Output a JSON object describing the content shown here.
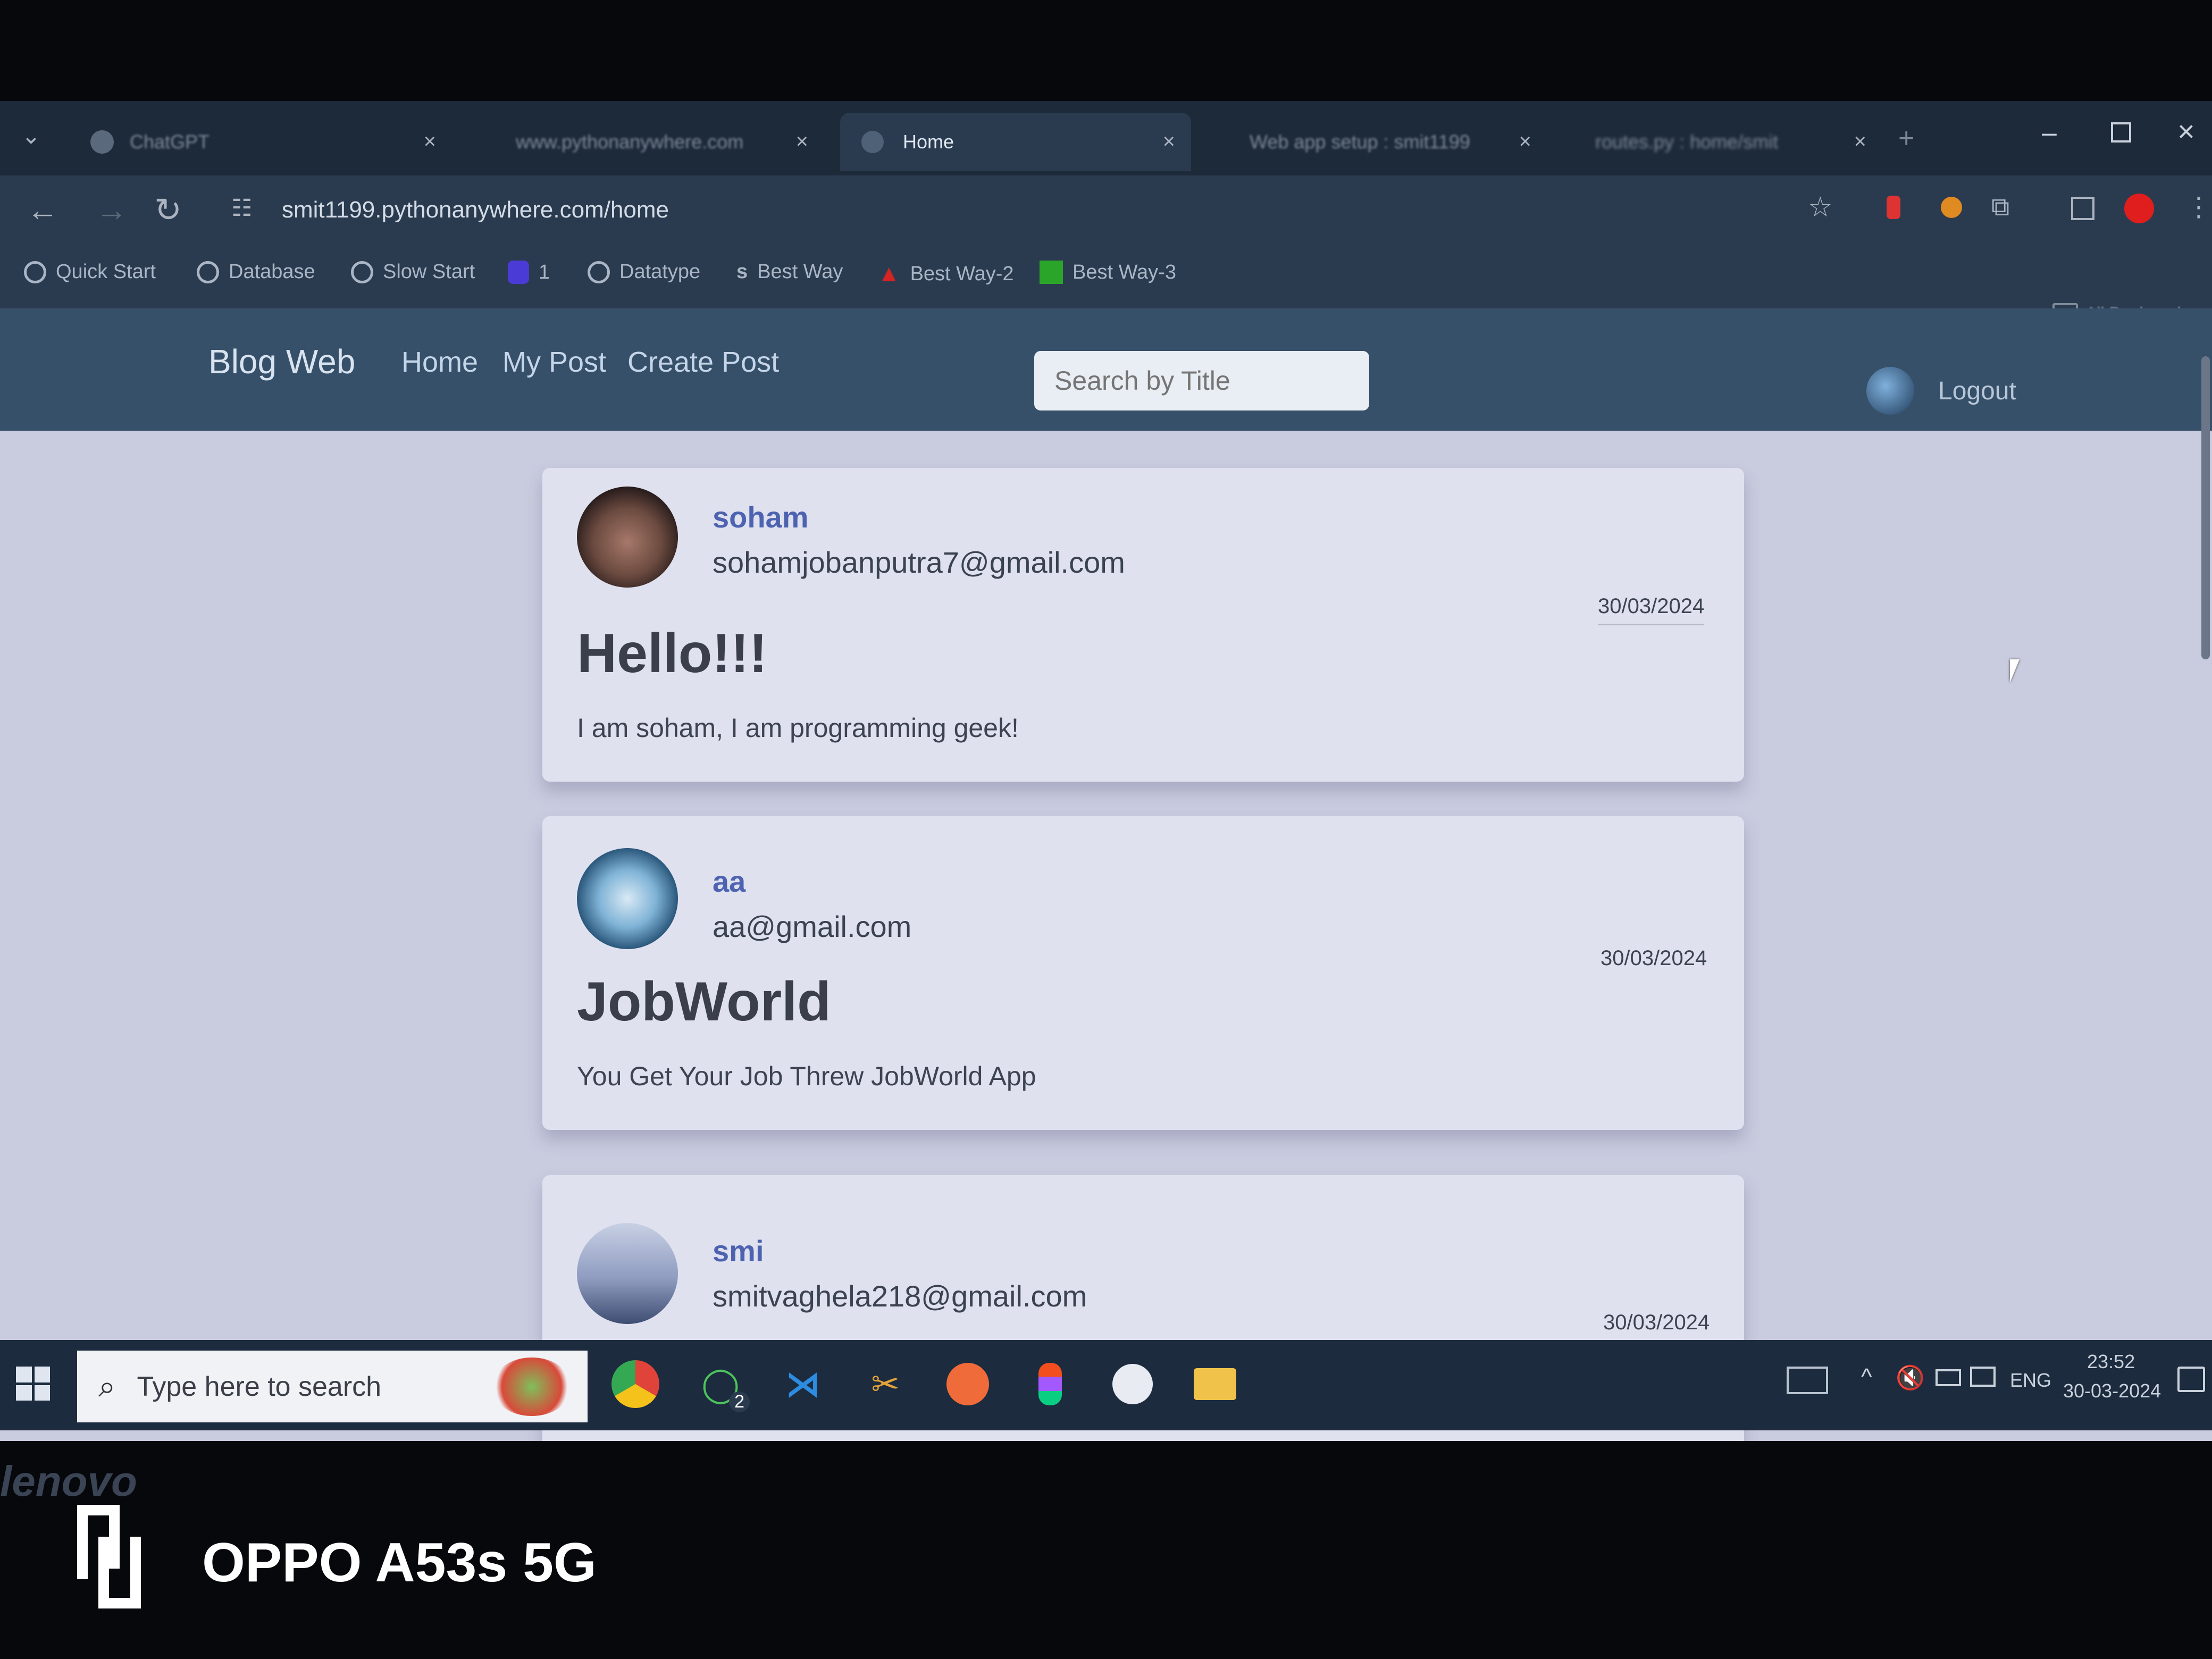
{
  "browser": {
    "tabs": [
      {
        "label": "ChatGPT",
        "active": false
      },
      {
        "label": "www.pythonanywhere.com",
        "active": false
      },
      {
        "label": "Home",
        "active": true
      },
      {
        "label": "Web app setup : smit1199",
        "active": false
      },
      {
        "label": "routes.py : home/smit",
        "active": false
      }
    ],
    "address": "smit1199.pythonanywhere.com/home",
    "bookmarks": [
      {
        "label": "Quick Start",
        "icon": "circle-icon"
      },
      {
        "label": "Database",
        "icon": "circle-icon"
      },
      {
        "label": "Slow Start",
        "icon": "circle-icon"
      },
      {
        "label": "1",
        "icon": "shield-icon"
      },
      {
        "label": "Datatype",
        "icon": "circle-icon"
      },
      {
        "label": "Best Way",
        "icon": "s-icon"
      },
      {
        "label": "Best Way-2",
        "icon": "cap-icon"
      },
      {
        "label": "Best Way-3",
        "icon": "dk-icon"
      }
    ],
    "all_bookmarks": "All Bookmarks"
  },
  "app": {
    "brand": "Blog Web",
    "nav": [
      "Home",
      "My Post",
      "Create Post"
    ],
    "search_placeholder": "Search by Title",
    "logout": "Logout"
  },
  "posts": [
    {
      "username": "soham",
      "email": "sohamjobanputra7@gmail.com",
      "date": "30/03/2024",
      "title": "Hello!!!",
      "body": "I am soham, I am programming geek!"
    },
    {
      "username": "aa",
      "email": "aa@gmail.com",
      "date": "30/03/2024",
      "title": "JobWorld",
      "body": "You Get Your Job Threw JobWorld App"
    },
    {
      "username": "smi",
      "email": "smitvaghela218@gmail.com",
      "date": "30/03/2024",
      "title": "",
      "body": ""
    }
  ],
  "taskbar": {
    "search_placeholder": "Type here to search",
    "whatsapp_badge": "2",
    "language": "ENG",
    "time": "23:52",
    "date": "30-03-2024"
  },
  "device": {
    "laptop_brand": "lenovo",
    "camera_caption": "OPPO A53s 5G"
  },
  "colors": {
    "navbar": "#36506a",
    "username": "#4e63b0",
    "page_bg": "#c9cbdf"
  }
}
